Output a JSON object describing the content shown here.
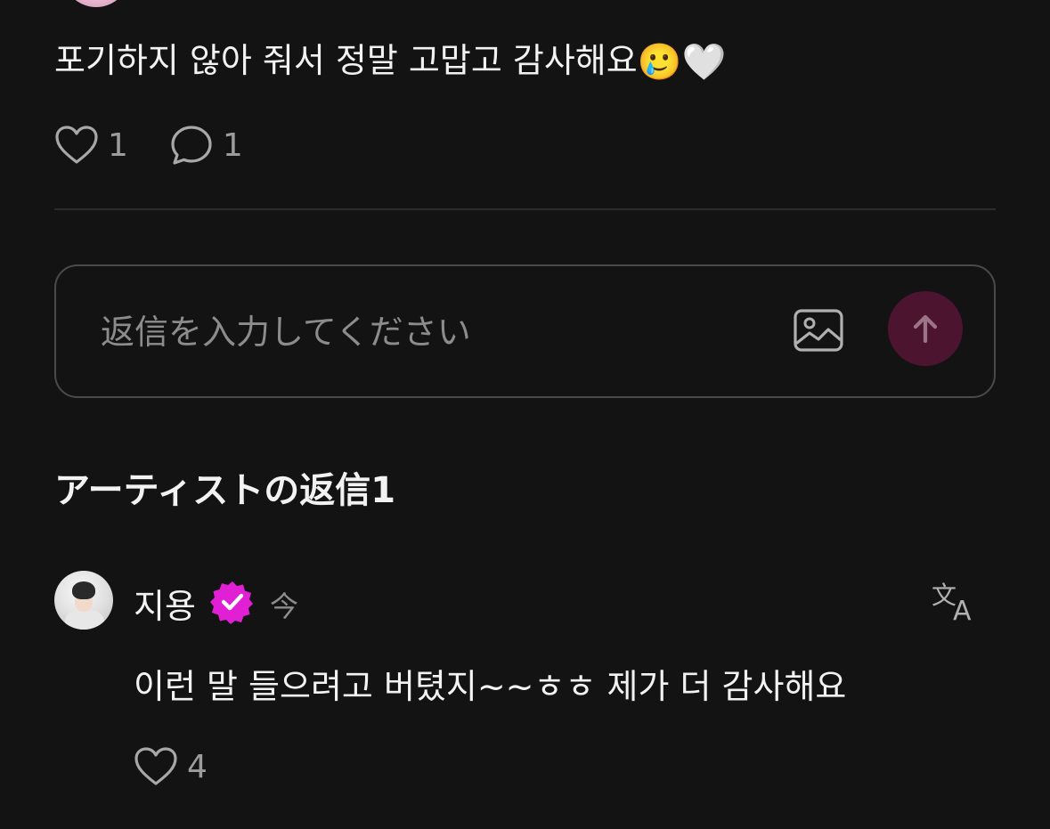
{
  "post": {
    "text": "포기하지 않아 줘서 정말 고맙고 감사해요",
    "emojis": "🥲🤍",
    "like_count": "1",
    "comment_count": "1"
  },
  "reply_box": {
    "placeholder": "返信を入力してください",
    "image_icon": "image-icon",
    "send_icon": "arrow-up-icon",
    "send_color": "#4d1430"
  },
  "artist_replies": {
    "title": "アーティストの返信1",
    "items": [
      {
        "author": "지용",
        "badge_icon": "verified-badge-icon",
        "badge_color": "#e11fd4",
        "time": "今",
        "text": "이런 말 들으려고 버텼지~~ㅎㅎ 제가 더 감사해요",
        "like_count": "4",
        "translate_icon": "translate-icon"
      }
    ]
  }
}
